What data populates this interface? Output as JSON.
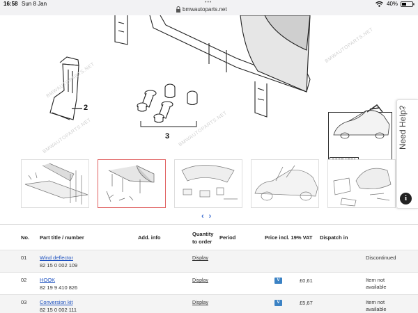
{
  "status_bar": {
    "time": "16:58",
    "date": "Sun 8 Jan",
    "url": "bmwautoparts.net",
    "battery": "40%"
  },
  "diagram": {
    "callouts": [
      "2",
      "3"
    ],
    "reference_code": "00054281",
    "watermark": "BMWAUTOPARTS.NET"
  },
  "help_tab": {
    "label": "Need Help?",
    "info_icon": "i"
  },
  "thumbnails": [
    {
      "name": "thumb-1",
      "active": false
    },
    {
      "name": "thumb-2",
      "active": true
    },
    {
      "name": "thumb-3",
      "active": false
    },
    {
      "name": "thumb-4",
      "active": false
    },
    {
      "name": "thumb-5",
      "active": false
    }
  ],
  "carousel": {
    "prev": "‹",
    "next": "›"
  },
  "table": {
    "headers": {
      "no": "No.",
      "part": "Part title / number",
      "info": "Add. info",
      "qty_line1": "Quantity",
      "qty_line2": "to order",
      "period": "Period",
      "price": "Price incl. 19% VAT",
      "dispatch": "Dispatch in"
    },
    "rows": [
      {
        "no": "01",
        "title": "Wind deflector",
        "number": "82 15 0 002 109",
        "qty": "Display",
        "price": "",
        "dispatch_line1": "Discontinued",
        "dispatch_line2": ""
      },
      {
        "no": "02",
        "title": "HOOK",
        "number": "82 19 9 410 826",
        "qty": "Display",
        "price": "£0,61",
        "dispatch_line1": "Item not",
        "dispatch_line2": "available"
      },
      {
        "no": "03",
        "title": "Conversion kit",
        "number": "82 15 0 002 111",
        "qty": "Display",
        "price": "£5,67",
        "dispatch_line1": "Item not",
        "dispatch_line2": "available"
      }
    ],
    "badge_label": "V"
  },
  "colors": {
    "link": "#1a4fbf",
    "active_thumb_border": "#e06060",
    "badge": "#3b82c4"
  }
}
